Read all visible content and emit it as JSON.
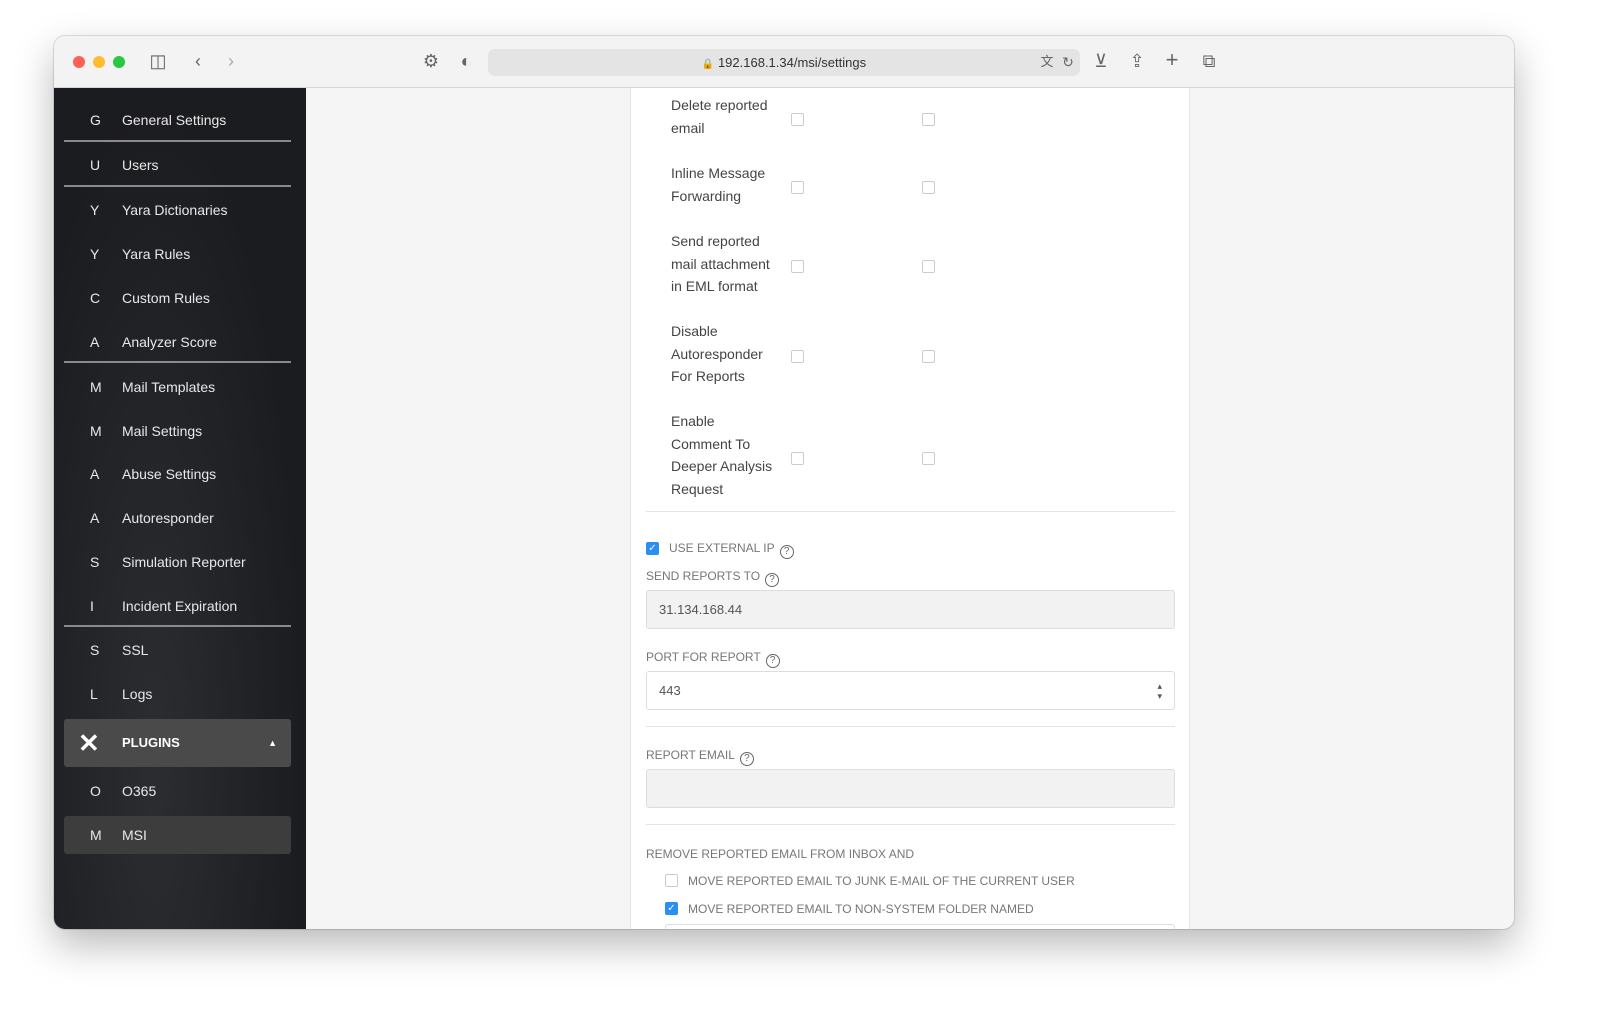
{
  "browser": {
    "url": "192.168.1.34/msi/settings"
  },
  "sidebar": {
    "items": [
      {
        "letter": "G",
        "label": "General Settings"
      },
      {
        "letter": "U",
        "label": "Users"
      },
      {
        "letter": "Y",
        "label": "Yara Dictionaries"
      },
      {
        "letter": "Y",
        "label": "Yara Rules"
      },
      {
        "letter": "C",
        "label": "Custom Rules"
      },
      {
        "letter": "A",
        "label": "Analyzer Score"
      },
      {
        "letter": "M",
        "label": "Mail Templates"
      },
      {
        "letter": "M",
        "label": "Mail Settings"
      },
      {
        "letter": "A",
        "label": "Abuse Settings"
      },
      {
        "letter": "A",
        "label": "Autoresponder"
      },
      {
        "letter": "S",
        "label": "Simulation Reporter"
      },
      {
        "letter": "I",
        "label": "Incident Expiration"
      },
      {
        "letter": "S",
        "label": "SSL"
      },
      {
        "letter": "L",
        "label": "Logs"
      }
    ],
    "plugins_label": "PLUGINS",
    "plugin_items": [
      {
        "letter": "O",
        "label": "O365"
      },
      {
        "letter": "M",
        "label": "MSI"
      }
    ]
  },
  "form": {
    "rows": [
      {
        "lines": [
          "Delete reported",
          "email"
        ]
      },
      {
        "lines": [
          "Inline Message",
          "Forwarding"
        ]
      },
      {
        "lines": [
          "Send reported",
          "mail attachment",
          "in EML format"
        ]
      },
      {
        "lines": [
          "Disable",
          "Autoresponder",
          "For Reports"
        ]
      },
      {
        "lines": [
          "Enable",
          "Comment To",
          "Deeper Analysis",
          "Request"
        ]
      }
    ],
    "use_external_ip": {
      "label": "USE EXTERNAL IP",
      "checked": true
    },
    "send_reports_to": {
      "label": "SEND REPORTS TO",
      "value": "31.134.168.44"
    },
    "port": {
      "label": "PORT FOR REPORT",
      "value": "443"
    },
    "report_email": {
      "label": "REPORT EMAIL",
      "value": ""
    },
    "remove_label": "REMOVE REPORTED EMAIL FROM INBOX AND",
    "opt_junk": {
      "label": "MOVE REPORTED EMAIL TO JUNK E-MAIL OF THE CURRENT USER",
      "checked": false
    },
    "opt_folder": {
      "label": "MOVE REPORTED EMAIL TO NON-SYSTEM FOLDER NAMED",
      "checked": true
    }
  },
  "help_glyph": "?"
}
